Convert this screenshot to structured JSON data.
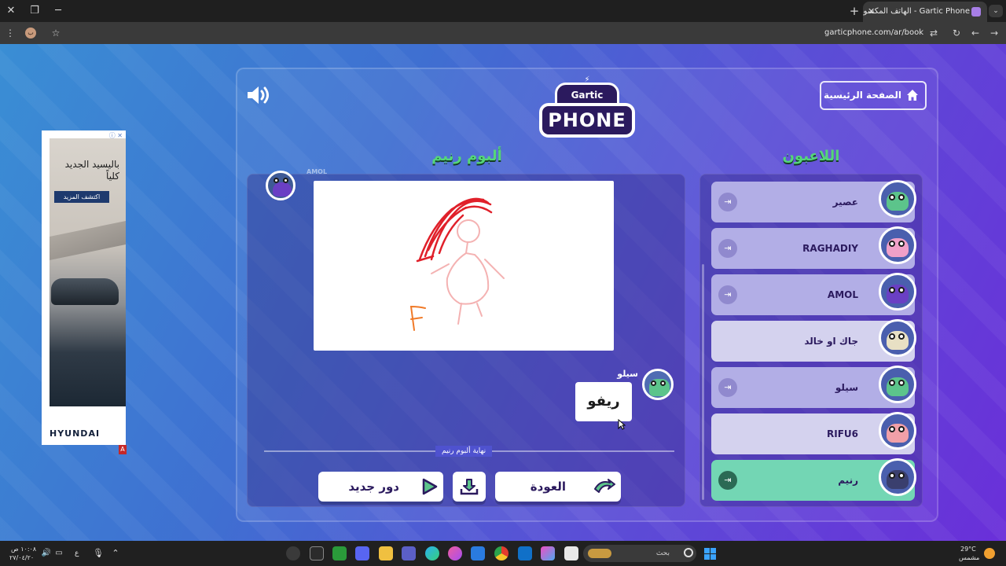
{
  "browser": {
    "tab_title": "Gartic Phone - الهاتف المكسور",
    "url": "garticphone.com/ar/book",
    "new_tab": "+",
    "close_tab": "✕",
    "window_close": "✕",
    "window_restore": "❐",
    "window_minimize": "─",
    "profile_initial": "ب"
  },
  "ad": {
    "title": "باليسيد الجديد كلياً",
    "cta": "اكتشف المزيد",
    "brand": "HYUNDAI",
    "info_icon": "ⓘ ✕",
    "badge": "A"
  },
  "game": {
    "home_button": "الصفحة الرئيسية",
    "logo_top": "Gartic",
    "logo_bottom": "PHONE",
    "album_title": "ألبوم رنيم",
    "players_title": "اللاعبون",
    "drawer_name": "AMOL",
    "guesser_name": "سيلو",
    "guess_text": "ريفو",
    "end_label": "نهاية ألبوم رنيم",
    "buttons": {
      "new_round": "دور جديد",
      "back": "العودة"
    },
    "players": [
      {
        "name": "عصير",
        "state": "dim",
        "color": "#5cc48b"
      },
      {
        "name": "RAGHADIY",
        "state": "dim",
        "color": "#f0a0c8"
      },
      {
        "name": "AMOL",
        "state": "dim",
        "color": "#6a3fc4"
      },
      {
        "name": "جاك او خالد",
        "state": "lite",
        "color": "#e8e0c4"
      },
      {
        "name": "سيلو",
        "state": "dim",
        "color": "#5cc48b"
      },
      {
        "name": "RIFU6",
        "state": "lite",
        "color": "#f0a0a8"
      },
      {
        "name": "رنيم",
        "state": "me",
        "color": "#3a3f6e"
      }
    ]
  },
  "taskbar": {
    "search_placeholder": "بحث",
    "weather_temp": "29°C",
    "weather_desc": "مشمس",
    "time": "١٠:٠٨ ص",
    "date": "٢٧/٠٤/٢٠",
    "lang": "ع"
  }
}
